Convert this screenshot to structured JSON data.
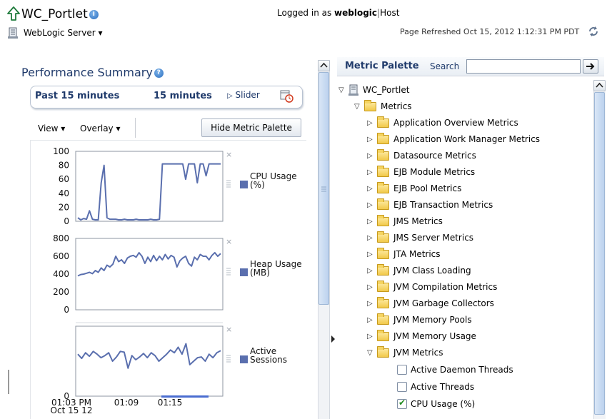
{
  "header": {
    "title": "WC_Portlet",
    "server_menu": "WebLogic Server ▾",
    "login_prefix": "Logged in as ",
    "login_user": "weblogic",
    "login_sep": "|",
    "login_host": "Host",
    "refreshed": "Page Refreshed Oct 15, 2012 1:12:31 PM PDT"
  },
  "perf": {
    "title": "Performance Summary",
    "range_past": "Past 15 minutes",
    "range_len": "15 minutes",
    "slider": "Slider",
    "view_menu": "View ▾",
    "overlay_menu": "Overlay ▾",
    "hide_palette": "Hide Metric Palette"
  },
  "chart_data": [
    {
      "type": "line",
      "legend": [
        "CPU Usage",
        "(%)"
      ],
      "ylim": [
        0,
        100
      ],
      "yticks": [
        "100",
        "80",
        "60",
        "40",
        "20",
        "0"
      ],
      "color": "#5a6fae",
      "values": [
        5,
        2,
        4,
        3,
        15,
        3,
        2,
        2,
        55,
        80,
        5,
        3,
        3,
        3,
        2,
        2,
        3,
        2,
        2,
        2,
        3,
        2,
        2,
        2,
        2,
        3,
        2,
        2,
        3,
        82,
        82,
        82,
        82,
        82,
        82,
        82,
        82,
        60,
        82,
        82,
        82,
        55,
        82,
        82,
        65,
        82,
        82,
        82,
        82,
        82
      ]
    },
    {
      "type": "line",
      "legend": [
        "Heap Usage",
        "(MB)"
      ],
      "ylim": [
        0,
        800
      ],
      "yticks": [
        "800",
        "600",
        "400",
        "200",
        "0"
      ],
      "color": "#5a6fae",
      "values": [
        380,
        395,
        400,
        410,
        420,
        405,
        440,
        420,
        470,
        440,
        500,
        480,
        510,
        600,
        540,
        560,
        520,
        580,
        600,
        610,
        590,
        640,
        600,
        520,
        590,
        540,
        610,
        550,
        600,
        560,
        620,
        570,
        610,
        590,
        480,
        550,
        580,
        600,
        520,
        490,
        590,
        560,
        620,
        600,
        600,
        560,
        610,
        640,
        600,
        630
      ]
    },
    {
      "type": "line",
      "legend": [
        "Active",
        "Sessions"
      ],
      "xticks": [
        "01:03 PM",
        "01:09",
        "01:15"
      ],
      "xsub": "Oct 15 12",
      "color": "#5a6fae",
      "values": [
        60,
        54,
        62,
        57,
        64,
        60,
        55,
        58,
        62,
        50,
        56,
        64,
        63,
        40,
        58,
        52,
        56,
        61,
        55,
        62,
        58,
        50,
        55,
        60,
        66,
        62,
        70,
        60,
        75,
        45,
        50,
        55,
        56,
        50,
        60,
        55,
        62,
        65
      ]
    }
  ],
  "palette": {
    "title": "Metric Palette",
    "search_label": "Search",
    "search_value": "",
    "root": "WC_Portlet",
    "metrics_folder": "Metrics",
    "folders": [
      "Application Overview Metrics",
      "Application Work Manager Metrics",
      "Datasource Metrics",
      "EJB Module Metrics",
      "EJB Pool Metrics",
      "EJB Transaction Metrics",
      "JMS Metrics",
      "JMS Server Metrics",
      "JTA Metrics",
      "JVM Class Loading",
      "JVM Compilation Metrics",
      "JVM Garbage Collectors",
      "JVM Memory Pools",
      "JVM Memory Usage"
    ],
    "open_folder": "JVM Metrics",
    "items": [
      {
        "label": "Active Daemon Threads",
        "checked": false
      },
      {
        "label": "Active Threads",
        "checked": false
      },
      {
        "label": "CPU Usage (%)",
        "checked": true
      }
    ]
  }
}
